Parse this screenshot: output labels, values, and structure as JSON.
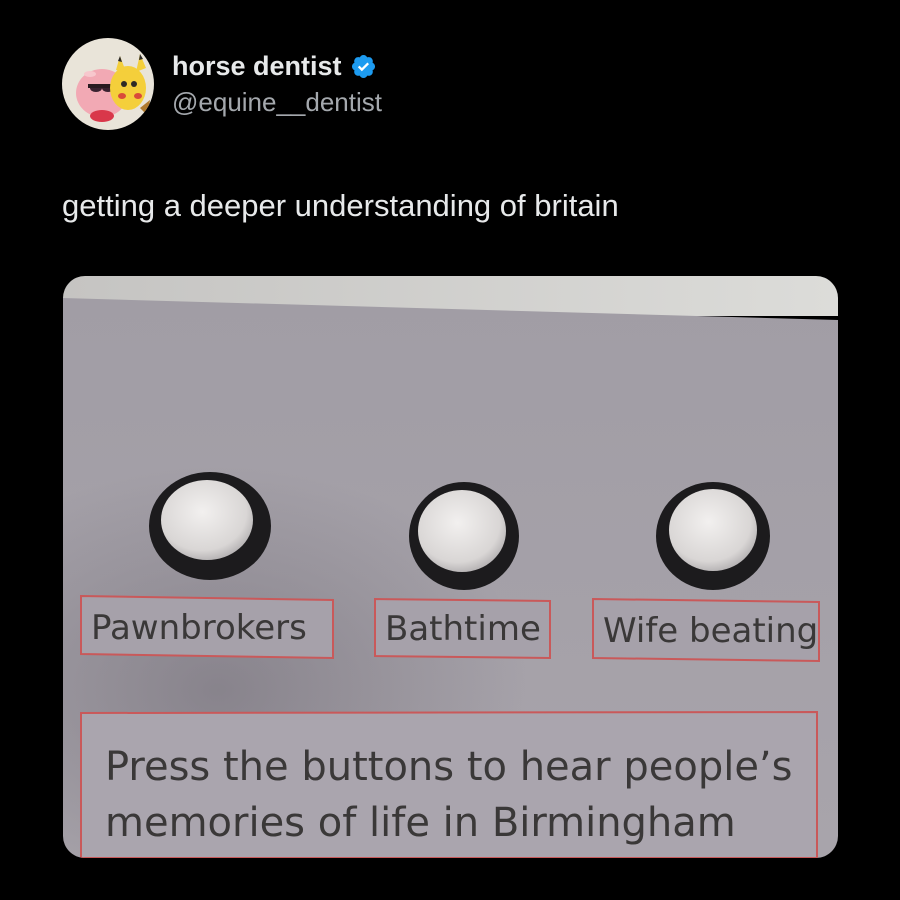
{
  "tweet": {
    "display_name": "horse dentist",
    "handle": "@equine__dentist",
    "text": "getting a deeper understanding of britain",
    "verified": true,
    "avatar_icon": "profile-avatar",
    "verified_icon": "verified-badge-icon"
  },
  "photo": {
    "buttons": [
      {
        "label": "Pawnbrokers"
      },
      {
        "label": "Bathtime"
      },
      {
        "label": "Wife beating"
      }
    ],
    "instruction_line1": "Press the buttons to hear people’s",
    "instruction_line2": "memories of life in Birmingham"
  },
  "colors": {
    "background": "#000000",
    "text_primary": "#e7e9ea",
    "text_secondary": "#a4a8ad",
    "verified_blue": "#1d9bf0",
    "panel_grey": "#9d98a1",
    "label_border_red": "#c9595a"
  }
}
